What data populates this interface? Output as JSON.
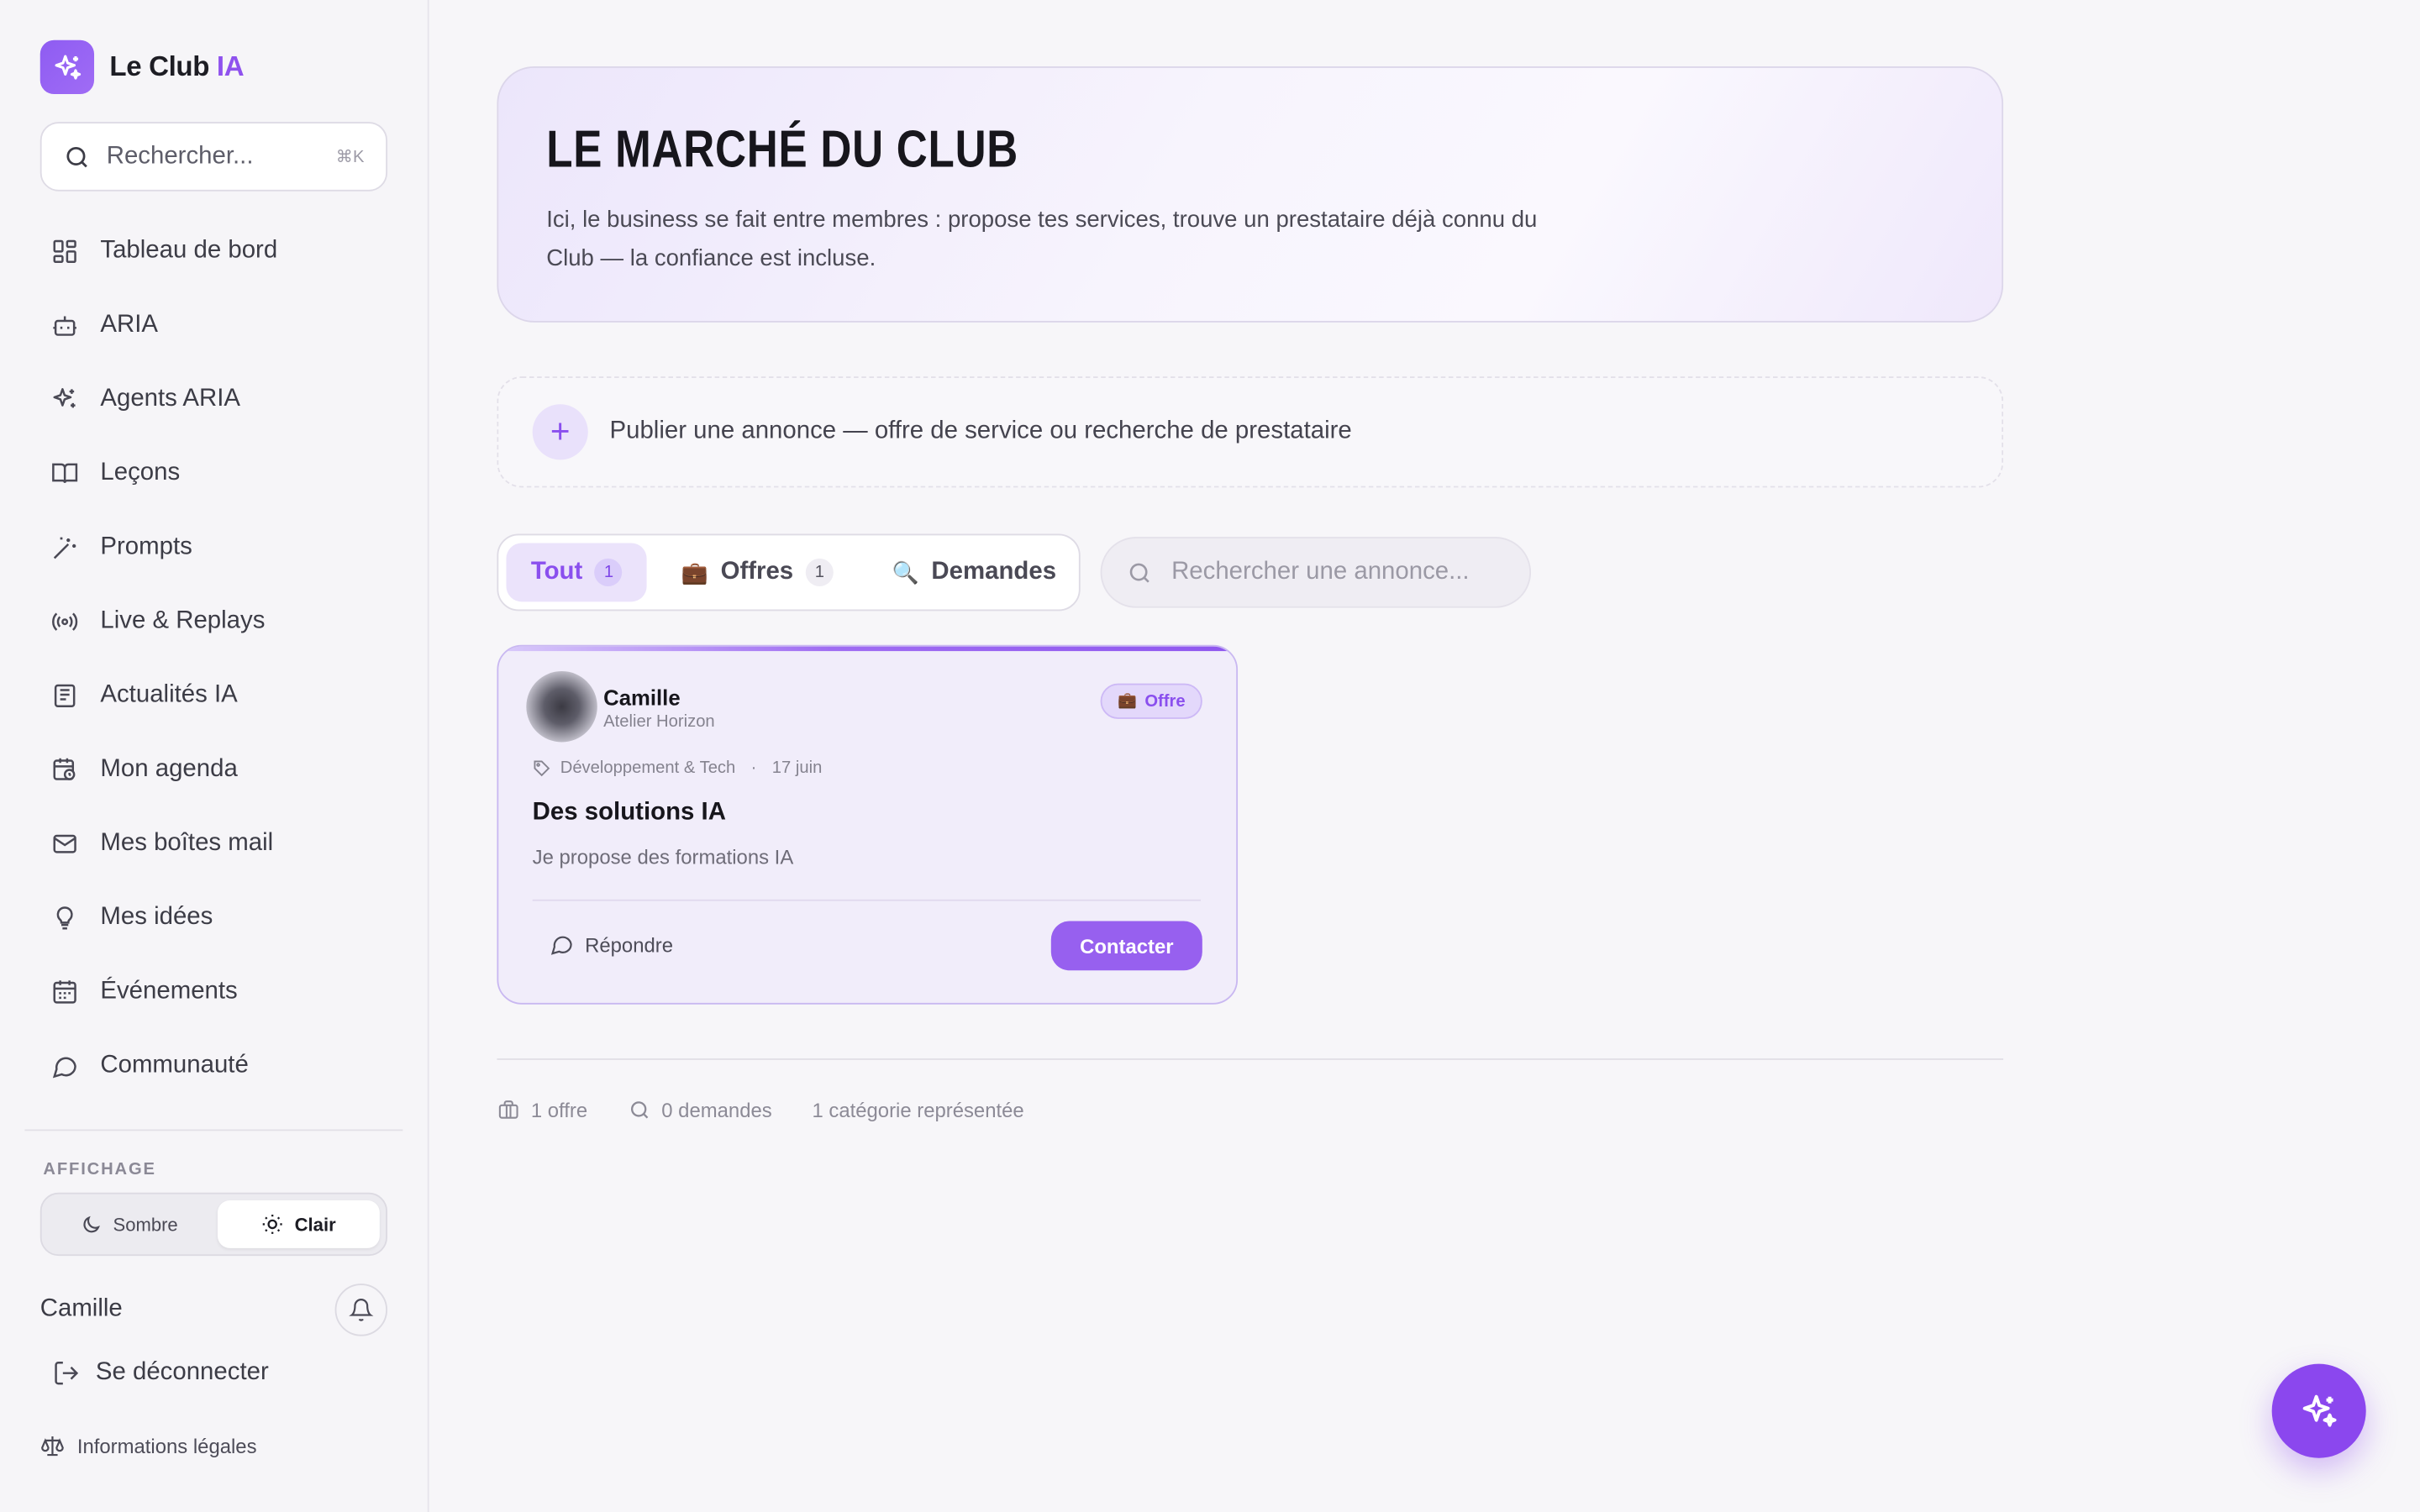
{
  "brand": {
    "name": "Le Club",
    "accent": "IA"
  },
  "sidebar": {
    "search": {
      "placeholder": "Rechercher...",
      "shortcut": "⌘K"
    },
    "items": [
      {
        "label": "Tableau de bord",
        "icon": "dashboard-icon"
      },
      {
        "label": "ARIA",
        "icon": "bot-icon"
      },
      {
        "label": "Agents ARIA",
        "icon": "sparkles-icon"
      },
      {
        "label": "Leçons",
        "icon": "book-icon"
      },
      {
        "label": "Prompts",
        "icon": "wand-icon"
      },
      {
        "label": "Live & Replays",
        "icon": "broadcast-icon"
      },
      {
        "label": "Actualités IA",
        "icon": "newspaper-icon"
      },
      {
        "label": "Mon agenda",
        "icon": "calendar-clock-icon"
      },
      {
        "label": "Mes boîtes mail",
        "icon": "mail-icon"
      },
      {
        "label": "Mes idées",
        "icon": "lightbulb-icon"
      },
      {
        "label": "Événements",
        "icon": "calendar-icon"
      },
      {
        "label": "Communauté",
        "icon": "chat-icon"
      }
    ],
    "display_label": "AFFICHAGE",
    "theme": {
      "dark": "Sombre",
      "light": "Clair",
      "selected": "Clair"
    },
    "user": "Camille",
    "logout": "Se déconnecter",
    "legal": "Informations légales"
  },
  "hero": {
    "title": "LE MARCHÉ DU CLUB",
    "subtitle": "Ici, le business se fait entre membres : propose tes services, trouve un prestataire déjà connu du Club — la confiance est incluse."
  },
  "publish": {
    "label": "Publier une annonce — offre de service ou recherche de prestataire"
  },
  "tabs": [
    {
      "label": "Tout",
      "count": "1",
      "active": true
    },
    {
      "label": "Offres",
      "count": "1",
      "emoji": "💼"
    },
    {
      "label": "Demandes",
      "emoji": "🔍"
    }
  ],
  "listing_search": {
    "placeholder": "Rechercher une annonce..."
  },
  "listing": {
    "name": "Camille",
    "company": "Atelier Horizon",
    "badge": "Offre",
    "category": "Développement & Tech",
    "date": "17 juin",
    "title": "Des solutions IA",
    "description": "Je propose des formations IA",
    "reply": "Répondre",
    "contact": "Contacter"
  },
  "stats": {
    "offers": "1 offre",
    "requests": "0 demandes",
    "categories": "1 catégorie représentée"
  },
  "colors": {
    "accent": "#8f52ee",
    "background": "#f7f6f9"
  }
}
